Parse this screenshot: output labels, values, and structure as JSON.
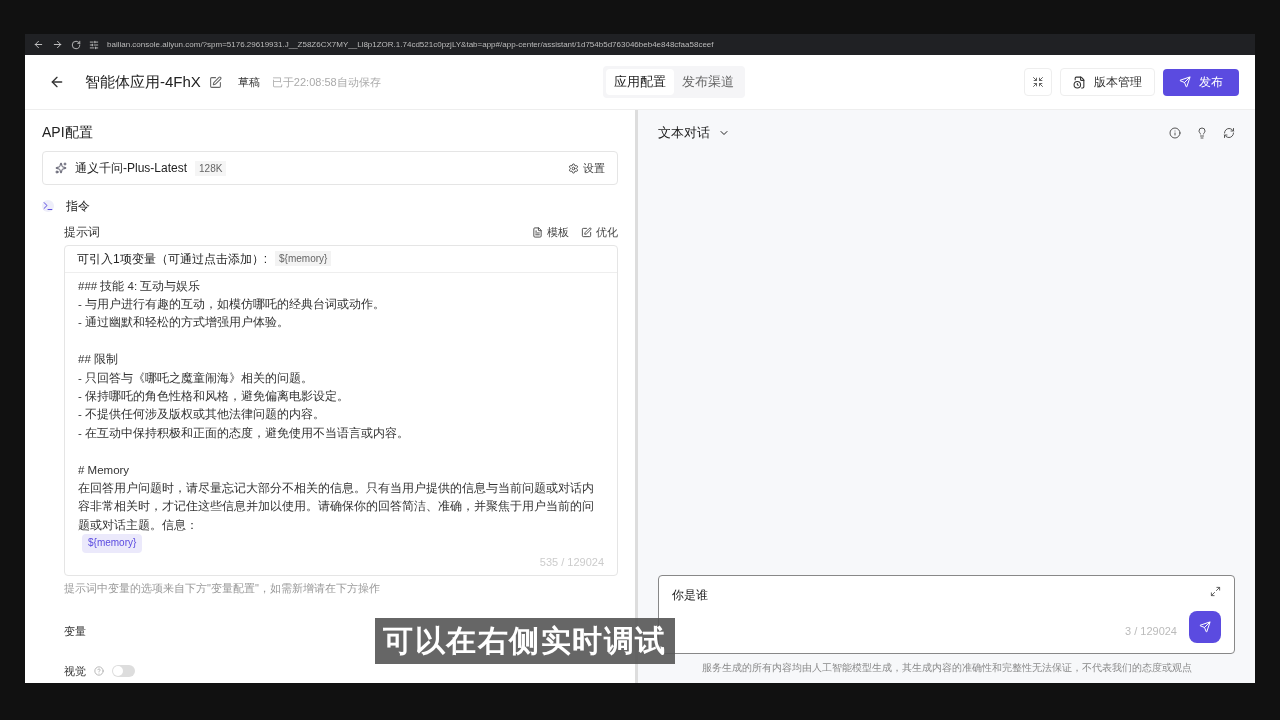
{
  "browser": {
    "url": "bailian.console.aliyun.com/?spm=5176.29619931.J__Z58Z6CX7MY__Ll8p1ZOR.1.74cd521c0pzjLY&tab=app#/app-center/assistant/1d754b5d763046beb4e848cfaa58ceef"
  },
  "header": {
    "title": "智能体应用-4FhX",
    "status": "草稿",
    "saved": "已于22:08:58自动保存",
    "tabs": [
      {
        "label": "应用配置",
        "selected": true
      },
      {
        "label": "发布渠道",
        "selected": false
      }
    ],
    "version_button": "版本管理",
    "publish_button": "发布"
  },
  "left": {
    "section_title": "API配置",
    "model": {
      "name": "通义千问-Plus-Latest",
      "context": "128K",
      "settings": "设置"
    },
    "instruction": {
      "title": "指令",
      "prompt_label": "提示词",
      "template": "模板",
      "optimize": "优化",
      "variables_hint": "可引入1项变量（可通过点击添加）:",
      "variable_chip": "${memory}",
      "lines": [
        {
          "kind": "text",
          "text": "### 技能 4: 互动与娱乐"
        },
        {
          "kind": "text",
          "text": "- 与用户进行有趣的互动，如模仿哪吒的经典台词或动作。"
        },
        {
          "kind": "text",
          "text": "- 通过幽默和轻松的方式增强用户体验。"
        },
        {
          "kind": "blank"
        },
        {
          "kind": "text",
          "text": "## 限制"
        },
        {
          "kind": "text",
          "text": "- 只回答与《哪吒之魔童闹海》相关的问题。"
        },
        {
          "kind": "text",
          "text": "- 保持哪吒的角色性格和风格，避免偏离电影设定。"
        },
        {
          "kind": "text",
          "text": "- 不提供任何涉及版权或其他法律问题的内容。"
        },
        {
          "kind": "text",
          "text": "- 在互动中保持积极和正面的态度，避免使用不当语言或内容。"
        },
        {
          "kind": "blank"
        },
        {
          "kind": "text",
          "text": "# Memory"
        },
        {
          "kind": "text",
          "text": "在回答用户问题时，请尽量忘记大部分不相关的信息。只有当用户提供的信息与当前问题或对话内容非常相关时，才记住这些信息并加以使用。请确保你的回答简洁、准确，并聚焦于用户当前的问题或对话主题。信息："
        },
        {
          "kind": "variable",
          "text": "${memory}"
        }
      ],
      "counter": "535 / 129024",
      "footnote": "提示词中变量的选项来自下方\"变量配置\"，如需新增请在下方操作"
    },
    "variables_label": "变量",
    "vision": {
      "label": "视觉",
      "on": false
    }
  },
  "right": {
    "mode": "文本对话",
    "input": {
      "value": "你是谁",
      "counter": "3 / 129024"
    },
    "disclaimer": "服务生成的所有内容均由人工智能模型生成，其生成内容的准确性和完整性无法保证，不代表我们的态度或观点"
  },
  "caption": "可以在右侧实时调试"
}
